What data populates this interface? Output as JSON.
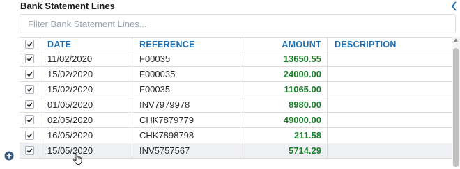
{
  "panel": {
    "title": "Bank Statement Lines"
  },
  "filter": {
    "placeholder": "Filter Bank Statement Lines..."
  },
  "columns": {
    "date": "DATE",
    "reference": "REFERENCE",
    "amount": "AMOUNT",
    "description": "DESCRIPTION"
  },
  "rows": [
    {
      "date": "11/02/2020",
      "reference": "F00035",
      "amount": "13650.55",
      "description": "",
      "checked": true
    },
    {
      "date": "15/02/2020",
      "reference": "F000035",
      "amount": "24000.00",
      "description": "",
      "checked": true
    },
    {
      "date": "15/02/2020",
      "reference": "F00035",
      "amount": "11065.00",
      "description": "",
      "checked": true
    },
    {
      "date": "01/05/2020",
      "reference": "INV7979978",
      "amount": "8980.00",
      "description": "",
      "checked": true
    },
    {
      "date": "02/05/2020",
      "reference": "CHK7879779",
      "amount": "49000.00",
      "description": "",
      "checked": true
    },
    {
      "date": "16/05/2020",
      "reference": "CHK7898798",
      "amount": "211.58",
      "description": "",
      "checked": true
    },
    {
      "date": "15/05/2020",
      "reference": "INV5757567",
      "amount": "5714.29",
      "description": "",
      "checked": true
    }
  ],
  "colors": {
    "header_text": "#1a6fb3",
    "amount_text": "#1a7f2a",
    "add_icon": "#3d5a80"
  },
  "icons": {
    "collapse": "chevron-left-icon",
    "add": "plus-circle-icon",
    "check": "checkmark-icon",
    "cursor": "hand-pointer-icon"
  }
}
